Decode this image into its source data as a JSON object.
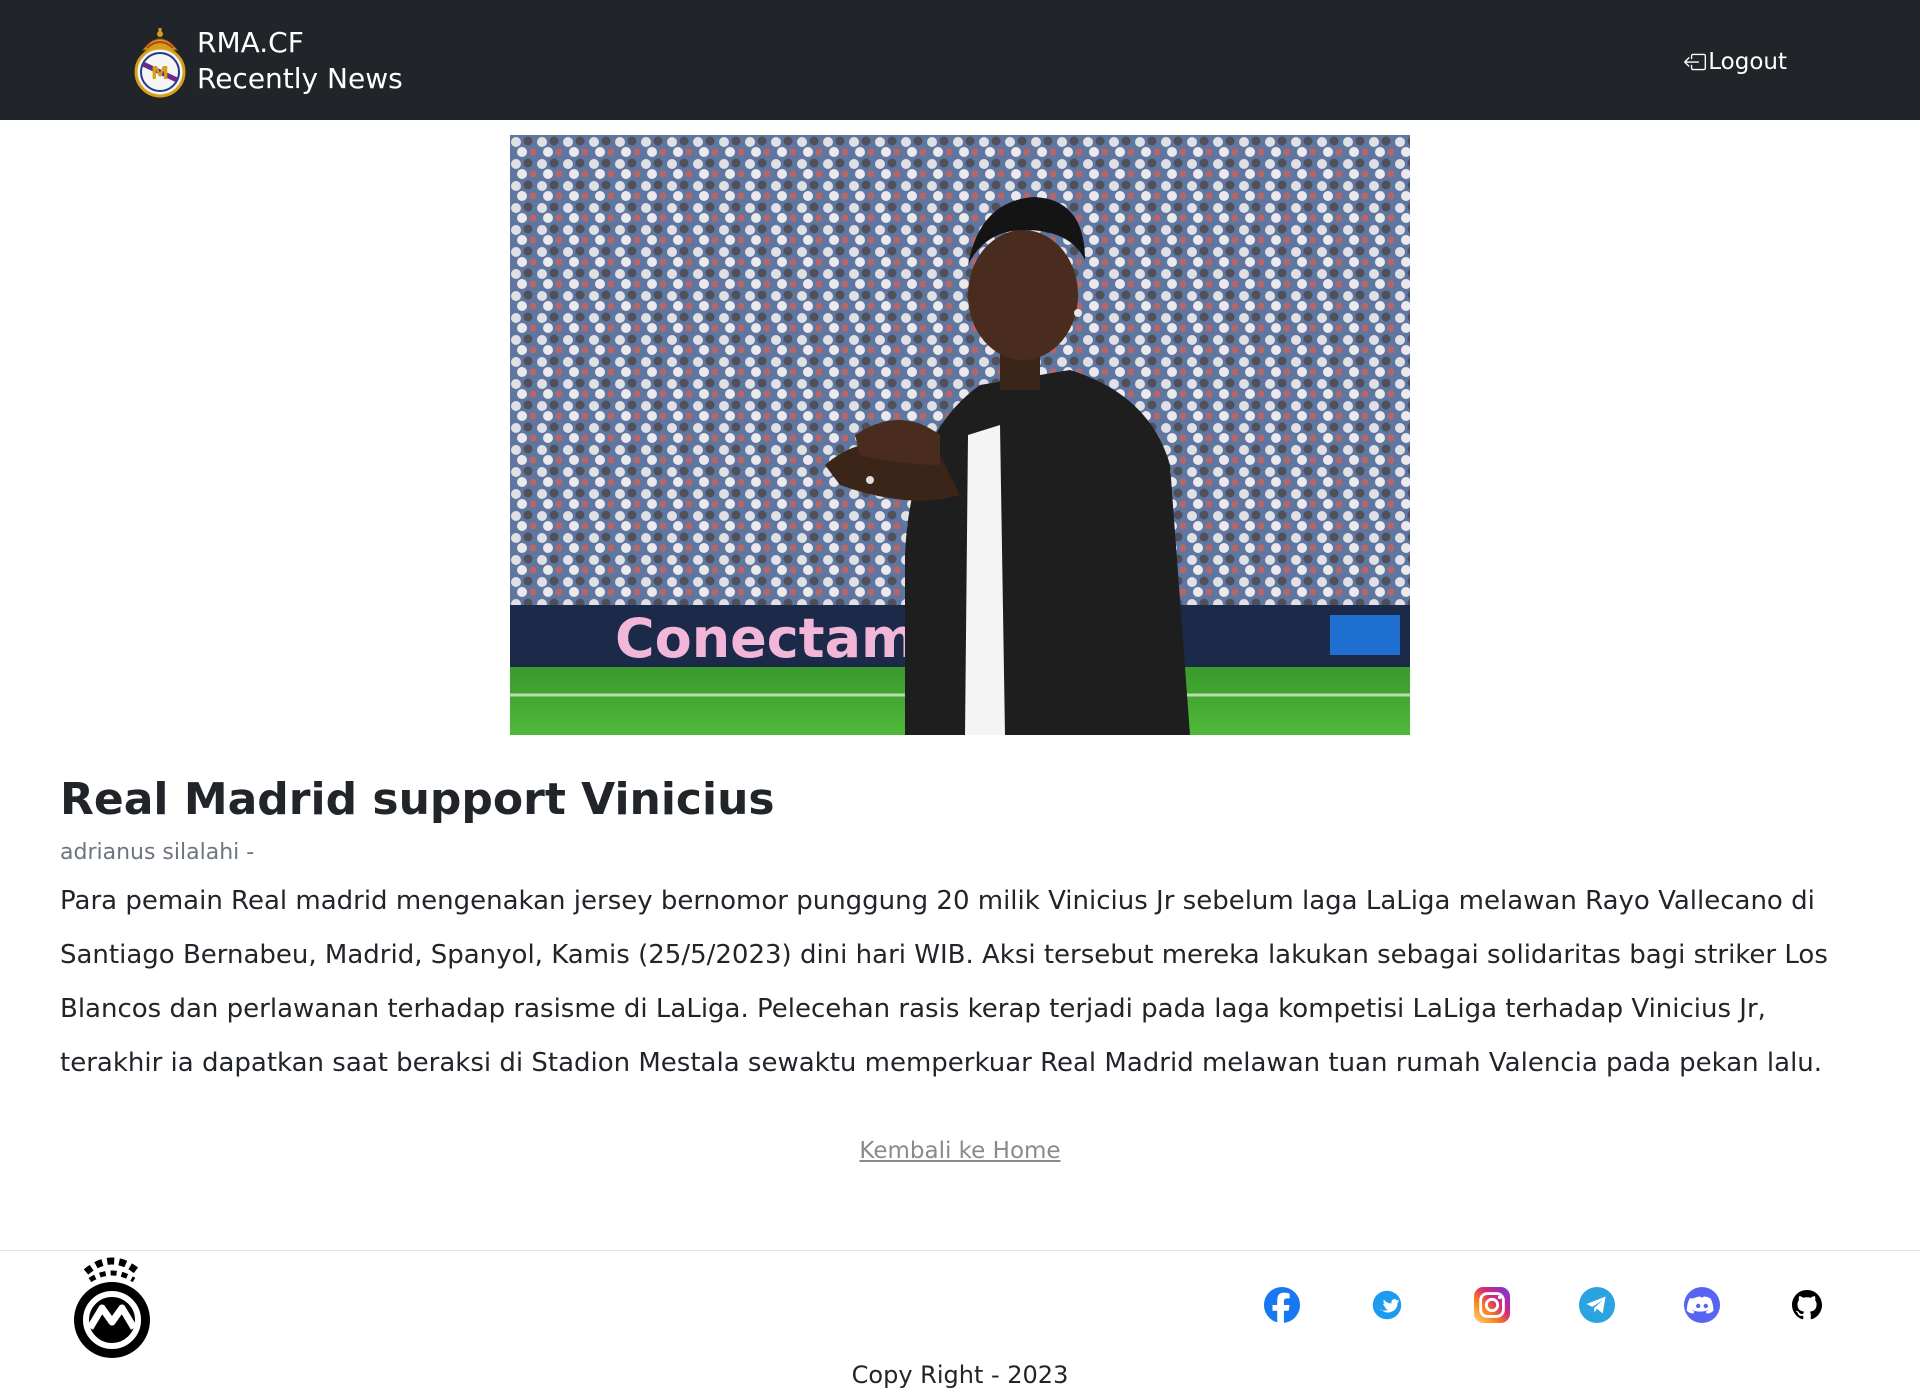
{
  "navbar": {
    "brand_line1": "RMA.CF",
    "brand_line2": "Recently News",
    "logout_label": "Logout"
  },
  "article": {
    "image_alt": "Vinicius Jr applauding at the stadium",
    "title": "Real Madrid support Vinicius",
    "author": "adrianus silalahi -",
    "body": "Para pemain Real madrid mengenakan jersey bernomor punggung 20 milik Vinicius Jr sebelum laga LaLiga melawan Rayo Vallecano di Santiago Bernabeu, Madrid, Spanyol, Kamis (25/5/2023) dini hari WIB. Aksi tersebut mereka lakukan sebagai solidaritas bagi striker Los Blancos dan perlawanan terhadap rasisme di LaLiga. Pelecehan rasis kerap terjadi pada laga kompetisi LaLiga terhadap Vinicius Jr, terakhir ia dapatkan saat beraksi di Stadion Mestala sewaktu memperkuar Real Madrid melawan tuan rumah Valencia pada pekan lalu.",
    "hero_banner_text": "Conectamos"
  },
  "back_link": "Kembali ke Home",
  "footer": {
    "socials": [
      "facebook-icon",
      "twitter-icon",
      "instagram-icon",
      "telegram-icon",
      "discord-icon",
      "github-icon"
    ],
    "copyright": "Copy Right - 2023"
  },
  "colors": {
    "navbar_bg": "#212529",
    "facebook": "#1877f2",
    "twitter": "#1d9bf0",
    "telegram": "#2aa3df",
    "discord": "#5865f2"
  }
}
